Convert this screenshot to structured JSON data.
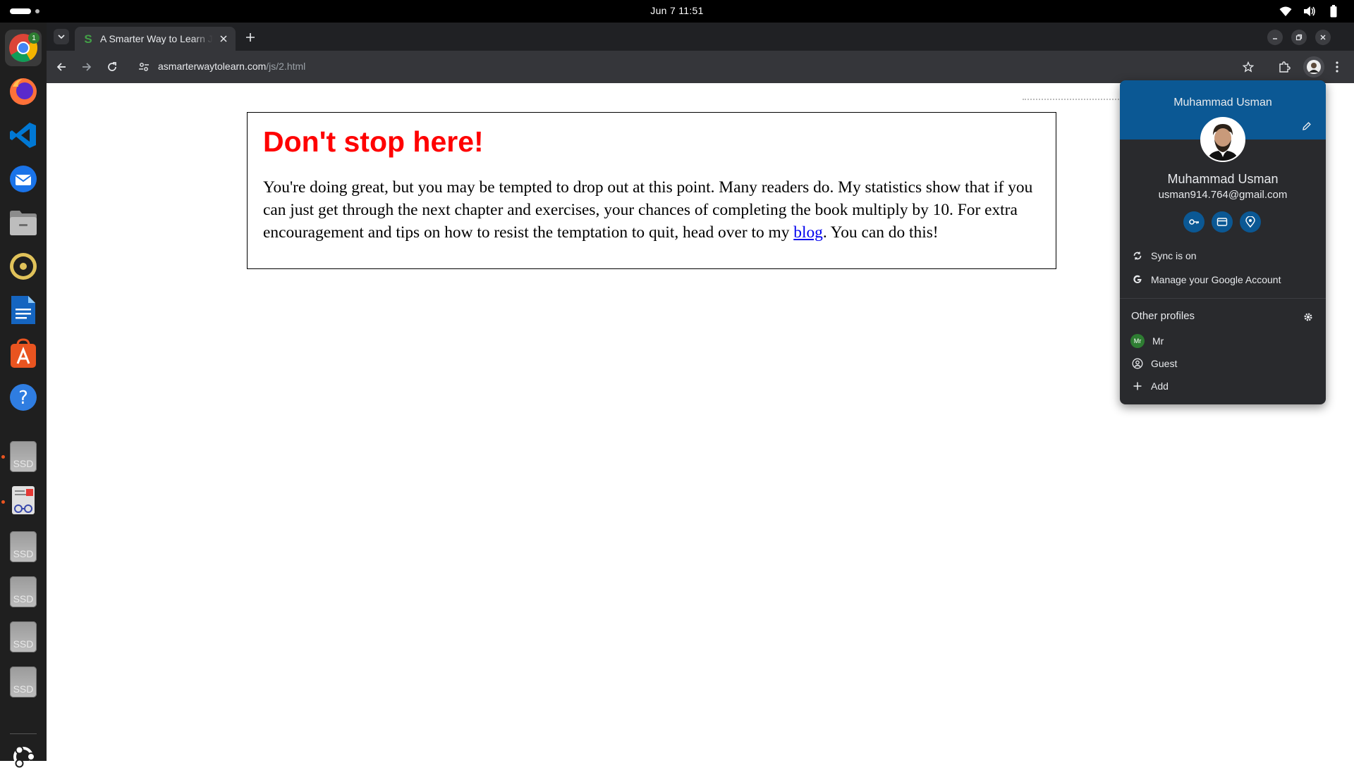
{
  "system": {
    "clock": "Jun 7  11:51",
    "tray_icons": [
      "wifi-icon",
      "volume-icon",
      "battery-icon"
    ]
  },
  "dock": {
    "items": [
      {
        "name": "chrome",
        "badge": "1"
      },
      {
        "name": "firefox"
      },
      {
        "name": "vscode"
      },
      {
        "name": "thunderbird"
      },
      {
        "name": "files"
      },
      {
        "name": "rhythmbox"
      },
      {
        "name": "writer"
      },
      {
        "name": "app-center"
      },
      {
        "name": "help"
      },
      {
        "name": "ssd-drive",
        "label": "SSD"
      },
      {
        "name": "document-viewer"
      },
      {
        "name": "ssd-drive",
        "label": "SSD"
      },
      {
        "name": "ssd-drive",
        "label": "SSD"
      },
      {
        "name": "ssd-drive",
        "label": "SSD"
      },
      {
        "name": "ssd-drive",
        "label": "SSD"
      },
      {
        "name": "show-apps"
      }
    ]
  },
  "browser": {
    "tab": {
      "title": "A Smarter Way to Learn JavaScript"
    },
    "url": {
      "host": "asmarterwaytolearn.com",
      "path": "/js/2.html"
    }
  },
  "page": {
    "heading": "Don't stop here!",
    "body_before": "You're doing great, but you may be tempted to drop out at this point. Many readers do. My statistics show that if you can just get through the next chapter and exercises, your chances of completing the book multiply by 10. For extra encouragement and tips on how to resist the temptation to quit, head over to my ",
    "link": "blog",
    "body_after": ". You can do this!"
  },
  "profile_menu": {
    "header_name": "Muhammad Usman",
    "name": "Muhammad Usman",
    "email": "usman914.764@gmail.com",
    "quick_icons": [
      "key-icon",
      "card-icon",
      "location-icon"
    ],
    "sync": "Sync is on",
    "manage": "Manage your Google Account",
    "other_profiles": "Other profiles",
    "profiles": [
      {
        "label": "Mr",
        "initials": "Mr"
      },
      {
        "label": "Guest"
      },
      {
        "label": "Add"
      }
    ],
    "colors": {
      "header": "#0b5894",
      "panel": "#292a2d"
    }
  }
}
